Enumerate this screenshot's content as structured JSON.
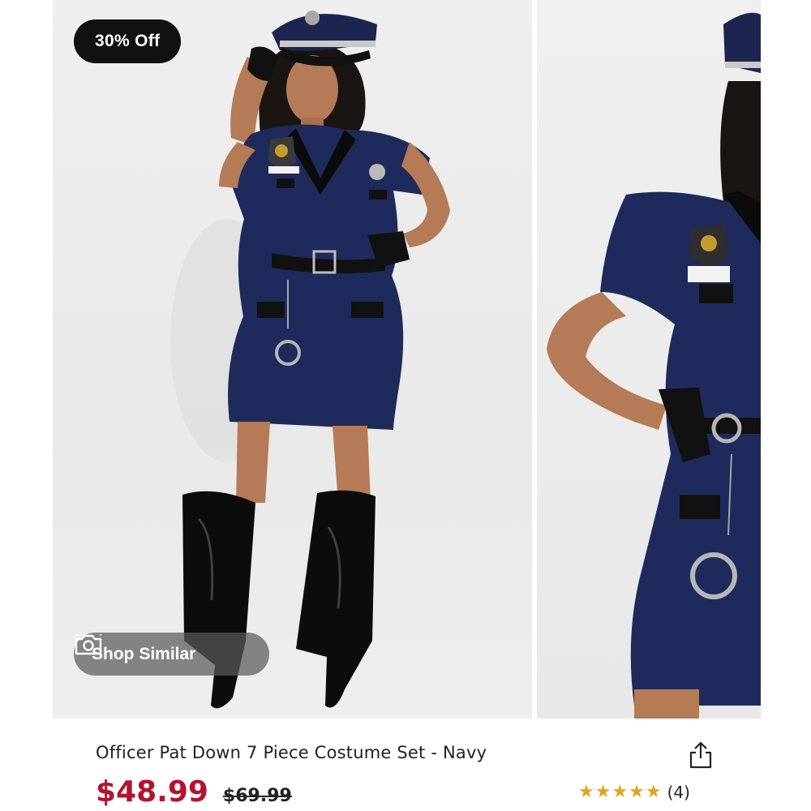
{
  "badge": {
    "discount": "30% Off"
  },
  "actions": {
    "shop_similar": "Shop Similar"
  },
  "product": {
    "title": "Officer Pat Down 7 Piece Costume Set - Navy",
    "price_current": "$48.99",
    "price_original": "$69.99",
    "rating_stars": "★★★★★",
    "rating_value": 5,
    "review_count": "(4)"
  },
  "colors": {
    "price_red": "#b3132f",
    "star_gold": "#e0a51d",
    "badge_black": "#111111",
    "dress_navy": "#1f2a5c"
  },
  "icons": {
    "camera": "camera-icon",
    "share": "share-icon",
    "star": "star-icon"
  }
}
